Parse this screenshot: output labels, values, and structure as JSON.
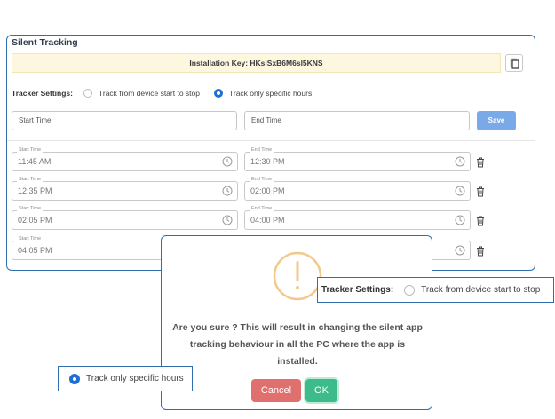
{
  "panel": {
    "title": "Silent Tracking",
    "installation_key": "Installation Key: HKslSxB6M6sl5KNS",
    "tracker_settings_label": "Tracker Settings:",
    "option_device_start_stop": "Track from device start to stop",
    "option_specific_hours": "Track only specific hours",
    "start_time_placeholder": "Start Time",
    "end_time_placeholder": "End Time",
    "save_label": "Save",
    "start_time_label": "Start Time",
    "end_time_label": "End Time",
    "rows": [
      {
        "start": "11:45 AM",
        "end": "12:30 PM"
      },
      {
        "start": "12:35 PM",
        "end": "02:00 PM"
      },
      {
        "start": "02:05 PM",
        "end": "04:00 PM"
      },
      {
        "start": "04:05 PM",
        "end": ""
      }
    ]
  },
  "dialog": {
    "message": "Are you sure ? This will result in changing the silent app tracking behaviour in all the PC where the app is installed.",
    "cancel_label": "Cancel",
    "ok_label": "OK"
  },
  "callout_right": {
    "label": "Tracker Settings:",
    "option": "Track from device start to stop"
  },
  "callout_left": {
    "option": "Track only specific hours"
  },
  "colors": {
    "accent": "#1f6fd0",
    "border": "#2f6fb0",
    "key_bg": "#fdf7e0",
    "save_bg": "#7aa9e8",
    "cancel_bg": "#e0706e",
    "ok_bg": "#3dbb8a",
    "warning": "#f2c98a"
  }
}
